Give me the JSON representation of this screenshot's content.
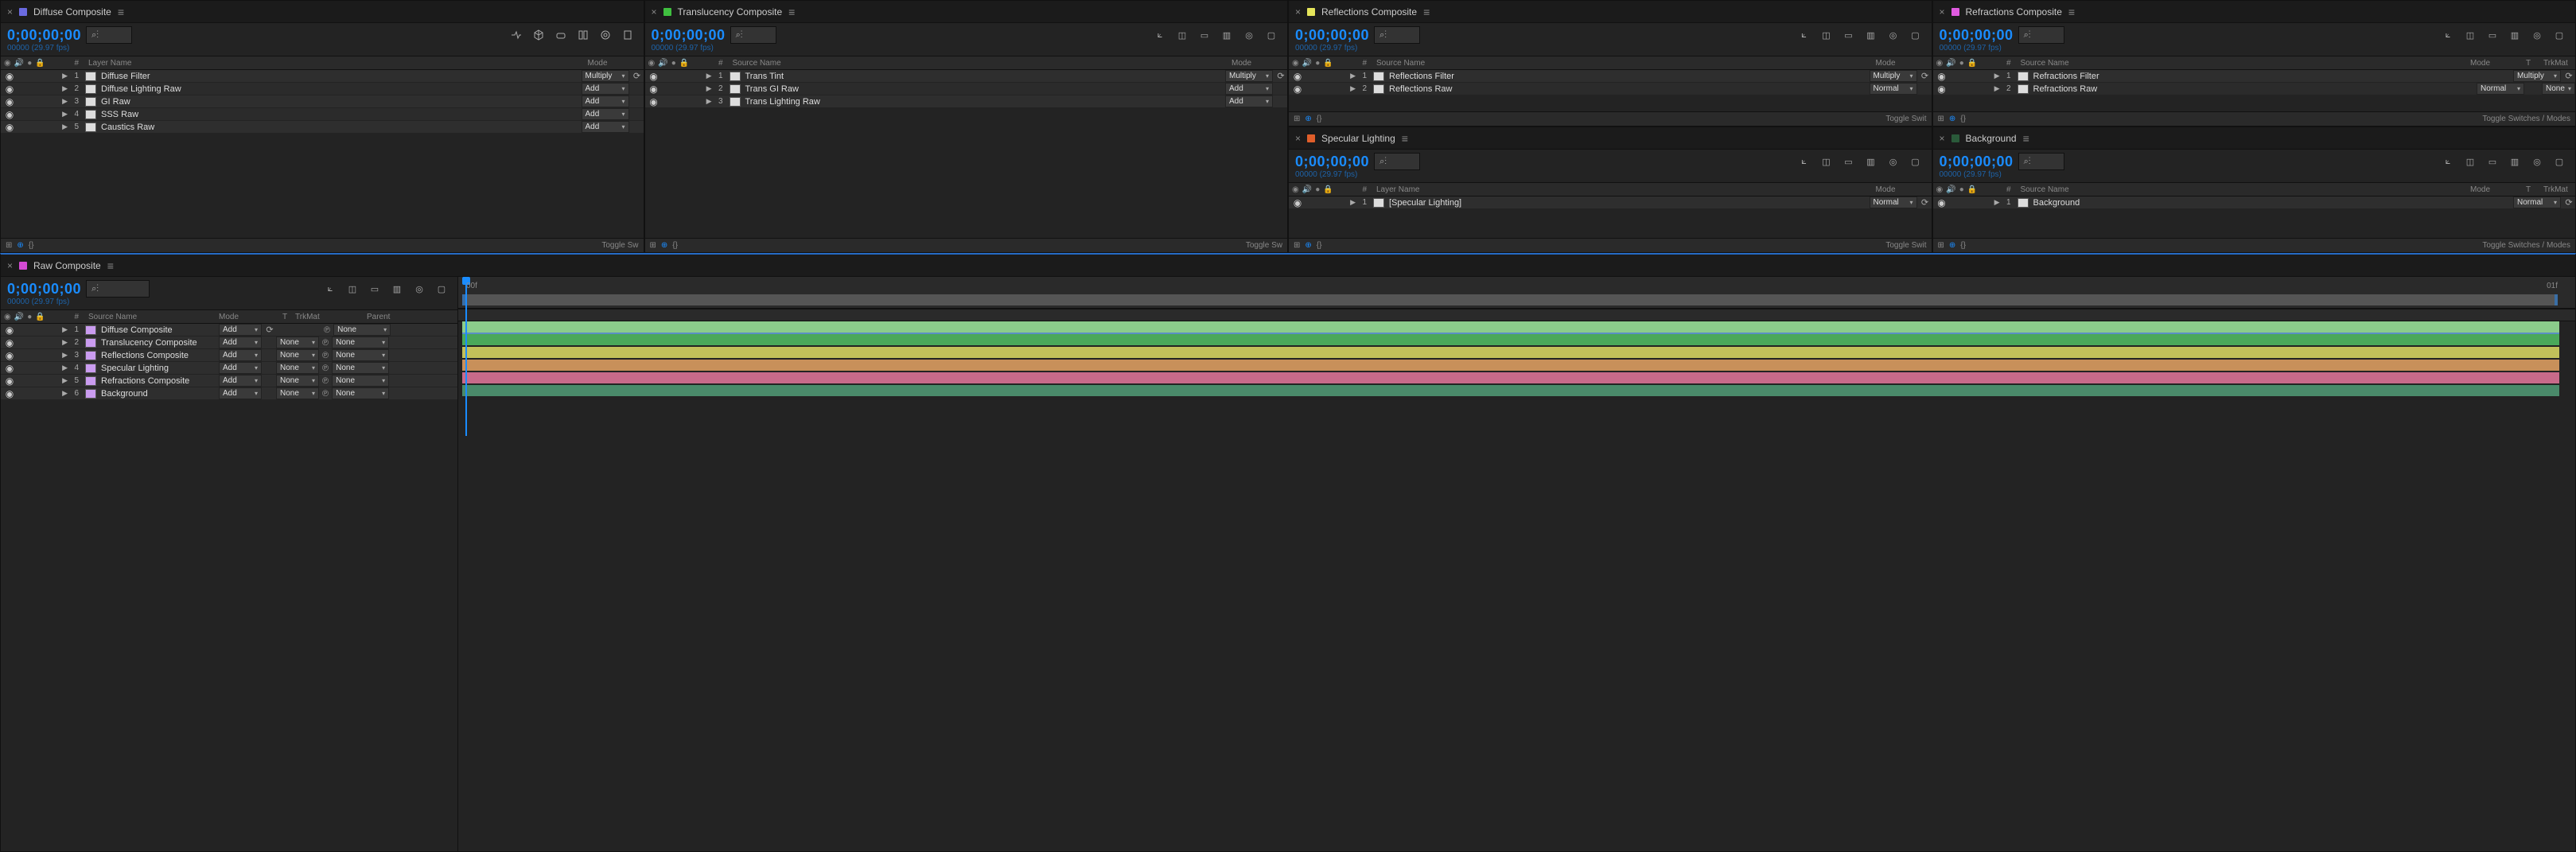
{
  "timecode": "0;00;00;00",
  "subtime": "00000 (29.97 fps)",
  "hdr": {
    "layerName": "Layer Name",
    "sourceName": "Source Name",
    "mode": "Mode",
    "num": "#",
    "trkmat": "TrkMat",
    "parent": "Parent",
    "t": "T"
  },
  "footer": {
    "toggleSw": "Toggle Sw",
    "toggleSwit": "Toggle Swit",
    "toggleFull": "Toggle Switches / Modes"
  },
  "modes": {
    "multiply": "Multiply",
    "add": "Add",
    "normal": "Normal"
  },
  "dd": {
    "none": "None"
  },
  "ruler": {
    "left": "00f",
    "right": "01f"
  },
  "panels": {
    "diffuse": {
      "title": "Diffuse Composite",
      "swatch": "#6a6ae0",
      "nameHeader": "Layer Name",
      "layers": [
        {
          "n": 1,
          "name": "Diffuse Filter",
          "mode": "Multiply"
        },
        {
          "n": 2,
          "name": "Diffuse Lighting Raw",
          "mode": "Add"
        },
        {
          "n": 3,
          "name": "GI Raw",
          "mode": "Add"
        },
        {
          "n": 4,
          "name": "SSS Raw",
          "mode": "Add"
        },
        {
          "n": 5,
          "name": "Caustics Raw",
          "mode": "Add"
        }
      ]
    },
    "trans": {
      "title": "Translucency Composite",
      "swatch": "#3fbf3f",
      "nameHeader": "Source Name",
      "layers": [
        {
          "n": 1,
          "name": "Trans Tint",
          "mode": "Multiply"
        },
        {
          "n": 2,
          "name": "Trans GI Raw",
          "mode": "Add"
        },
        {
          "n": 3,
          "name": "Trans Lighting Raw",
          "mode": "Add"
        }
      ]
    },
    "refl": {
      "title": "Reflections Composite",
      "swatch": "#e5e55a",
      "nameHeader": "Source Name",
      "layers": [
        {
          "n": 1,
          "name": "Reflections Filter",
          "mode": "Multiply"
        },
        {
          "n": 2,
          "name": "Reflections Raw",
          "mode": "Normal"
        }
      ]
    },
    "refr": {
      "title": "Refractions Composite",
      "swatch": "#e05ae0",
      "nameHeader": "Source Name",
      "extraCols": true,
      "layers": [
        {
          "n": 1,
          "name": "Refractions Filter",
          "mode": "Multiply"
        },
        {
          "n": 2,
          "name": "Refractions Raw",
          "mode": "Normal",
          "trkmat": "None"
        }
      ]
    },
    "spec": {
      "title": "Specular Lighting",
      "swatch": "#e05e2a",
      "nameHeader": "Layer Name",
      "layers": [
        {
          "n": 1,
          "name": "[Specular Lighting]",
          "mode": "Normal"
        }
      ]
    },
    "bg": {
      "title": "Background",
      "swatch": "#2a5a3a",
      "nameHeader": "Source Name",
      "layers": [
        {
          "n": 1,
          "name": "Background",
          "mode": "Normal"
        }
      ]
    },
    "raw": {
      "title": "Raw Composite",
      "swatch": "#d44ad4",
      "layers": [
        {
          "n": 1,
          "name": "Diffuse Composite",
          "mode": "Add",
          "trkmat": "",
          "parent": "None"
        },
        {
          "n": 2,
          "name": "Translucency Composite",
          "mode": "Add",
          "trkmat": "None",
          "parent": "None"
        },
        {
          "n": 3,
          "name": "Reflections Composite",
          "mode": "Add",
          "trkmat": "None",
          "parent": "None"
        },
        {
          "n": 4,
          "name": "Specular Lighting",
          "mode": "Add",
          "trkmat": "None",
          "parent": "None"
        },
        {
          "n": 5,
          "name": "Refractions Composite",
          "mode": "Add",
          "trkmat": "None",
          "parent": "None"
        },
        {
          "n": 6,
          "name": "Background",
          "mode": "Add",
          "trkmat": "None",
          "parent": "None"
        }
      ]
    }
  }
}
